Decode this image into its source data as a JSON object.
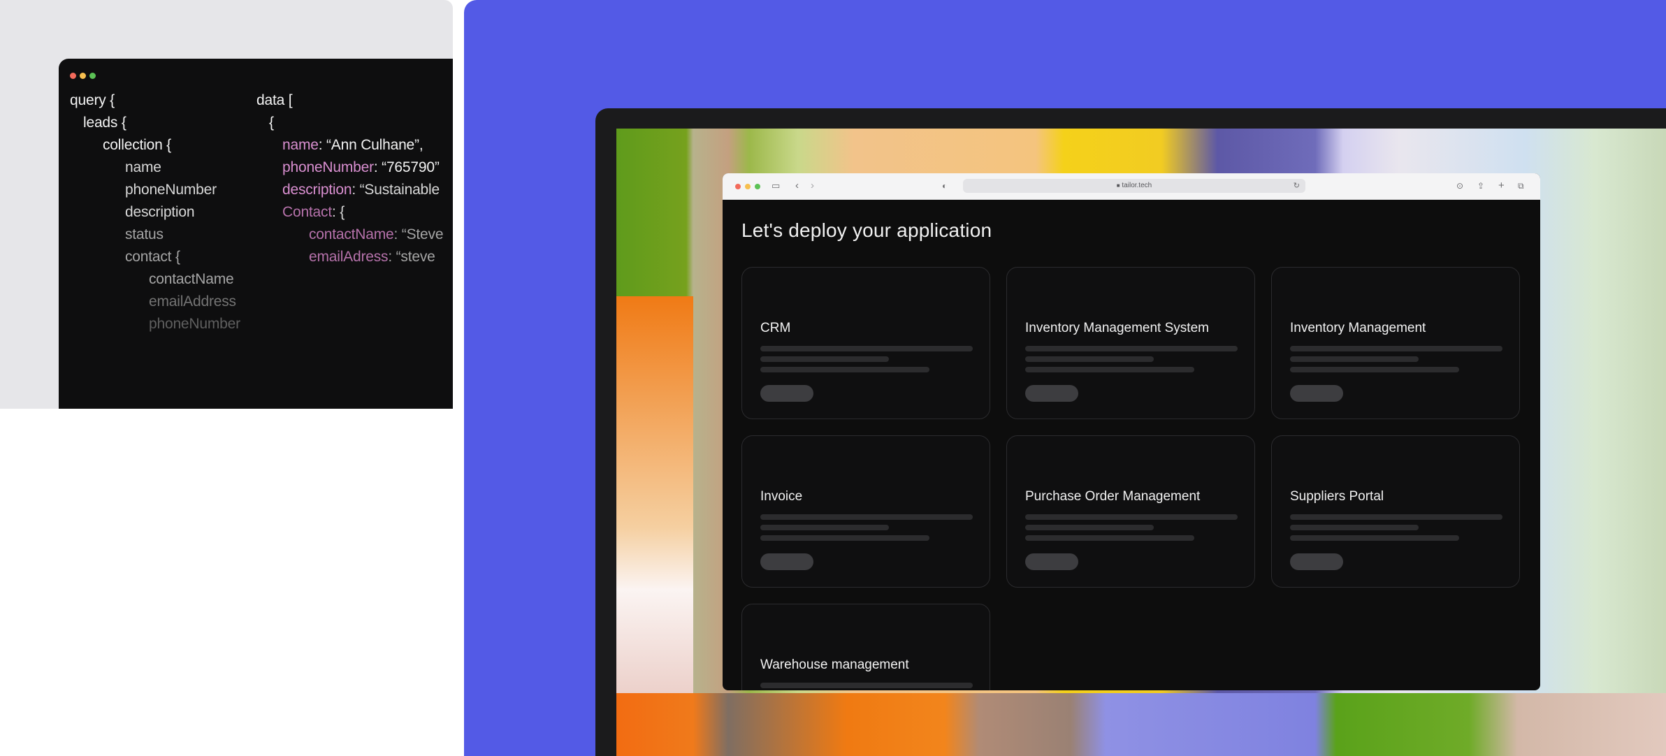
{
  "code_panel": {
    "query_lines": [
      "query {",
      "leads {",
      "collection {",
      "name",
      "phoneNumber",
      "description",
      "status",
      "contact {",
      "contactName",
      "emailAddress",
      "phoneNumber"
    ],
    "data_header": "data [",
    "data_open": "{",
    "data_lines": [
      {
        "key": "name",
        "value": ": “Ann Culhane”,"
      },
      {
        "key": "phoneNumber",
        "value": ": “765790”"
      },
      {
        "key": "description",
        "value": ": “Sustainable"
      },
      {
        "key": "Contact",
        "value": ": {"
      },
      {
        "key": "contactName",
        "value": ": “Steve"
      },
      {
        "key": "emailAdress",
        "value": ": “steve"
      }
    ]
  },
  "browser": {
    "url": "tailor.tech",
    "page_title": "Let's deploy your application",
    "cards": [
      {
        "title": "CRM"
      },
      {
        "title": "Inventory Management System"
      },
      {
        "title": "Inventory Management"
      },
      {
        "title": "Invoice"
      },
      {
        "title": "Purchase Order Management"
      },
      {
        "title": "Suppliers Portal"
      },
      {
        "title": "Warehouse management"
      }
    ]
  },
  "colors": {
    "accent_background": "#535ae6",
    "traffic_red": "#f26a5b",
    "traffic_yellow": "#f6bf4f",
    "traffic_green": "#5bc155",
    "code_key_pink": "#d98fd0"
  },
  "icons": [
    "sidebar-toggle-icon",
    "back-icon",
    "forward-icon",
    "shield-icon",
    "lock-icon",
    "reload-icon",
    "download-icon",
    "share-icon",
    "new-tab-icon",
    "tabs-overview-icon"
  ]
}
